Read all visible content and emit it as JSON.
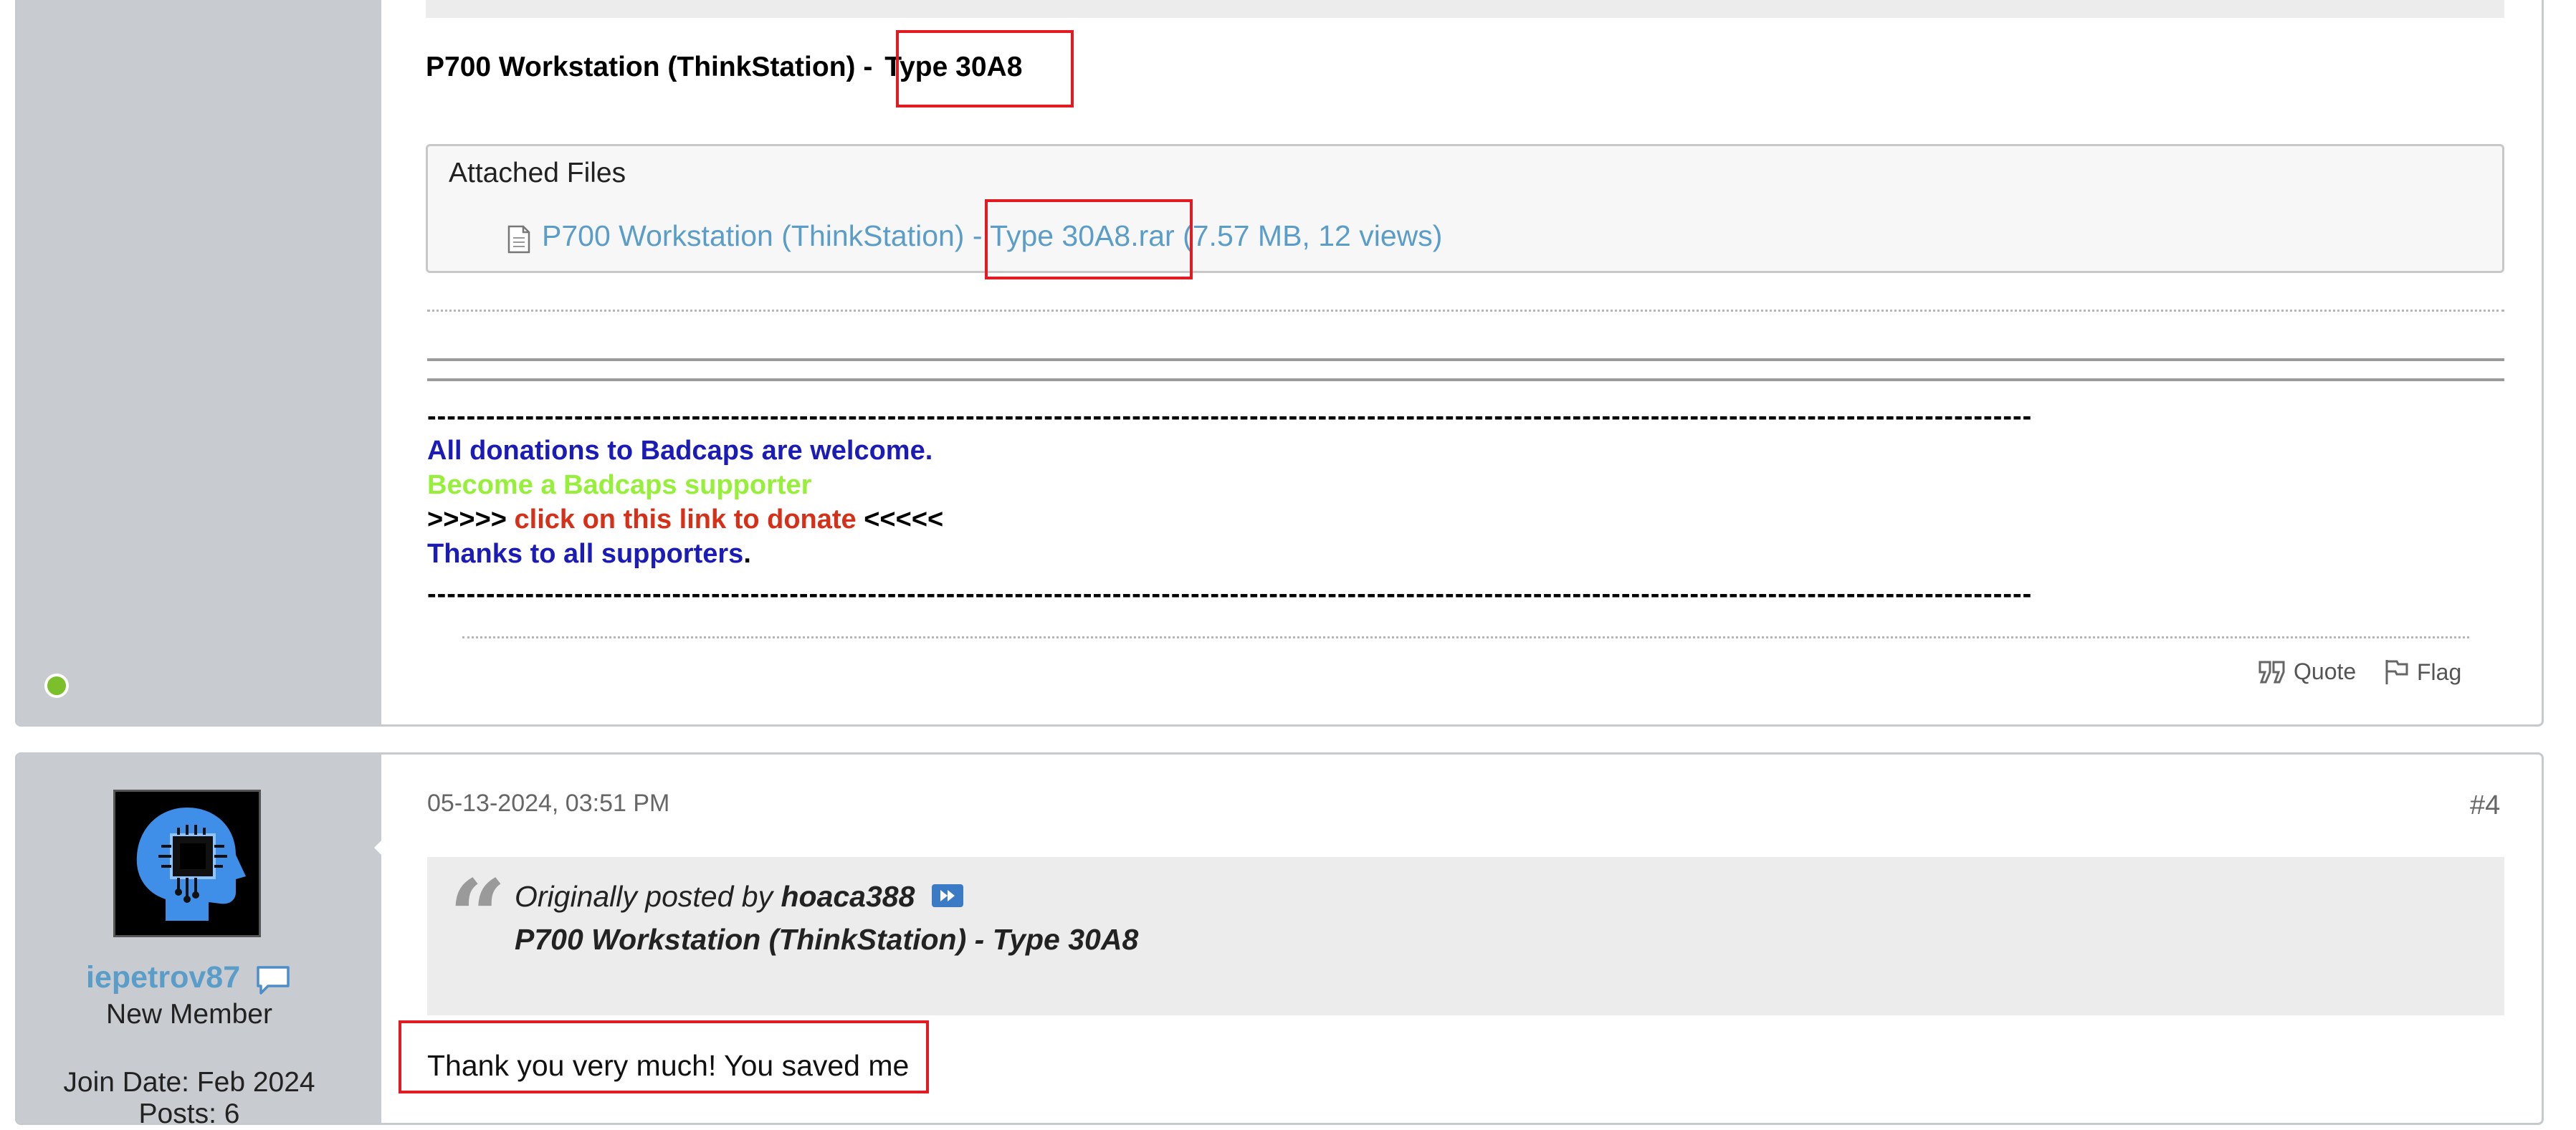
{
  "post1": {
    "title_prefix": "P700 Workstation (ThinkStation) -",
    "title_highlight": "Type 30A8",
    "attached_files_label": "Attached Files",
    "file": {
      "name_prefix": "P700 Workstation (ThinkStation) -",
      "name_highlight": "Type 30A8.rar",
      "meta": "(7.57 MB, 12 views)",
      "icon": "document-icon"
    },
    "signature": {
      "dashes": "--------------------------------------------------------------------------------------------------------------------------------------------------------------------",
      "line1": "All donations to Badcaps are welcome.",
      "line2": "Become a Badcaps supporter",
      "line3_prefix": ">>>>> ",
      "line3_link": "click on this link to donate",
      "line3_suffix": " <<<<<",
      "line4": "Thanks to all supporters",
      "line4_end": "."
    },
    "actions": {
      "quote": "Quote",
      "flag": "Flag"
    }
  },
  "post2": {
    "user": {
      "username": "iepetrov87",
      "title": "New Member",
      "join_date": "Join Date: Feb 2024",
      "posts": "Posts: 6"
    },
    "date": "05-13-2024, 03:51 PM",
    "number": "#4",
    "quote": {
      "prefix": "Originally posted by",
      "author": "hoaca388",
      "text": "P700 Workstation (ThinkStation) - Type 30A8"
    },
    "reply": "Thank you very much! You saved me"
  },
  "colors": {
    "link": "#5b9dc9",
    "highlight_border": "#e21b22",
    "sidebar": "#c8cbcf",
    "online": "#7bbf2a",
    "sig_blue": "#1b1bb8",
    "sig_green": "#96f03a",
    "sig_red": "#d73018"
  }
}
